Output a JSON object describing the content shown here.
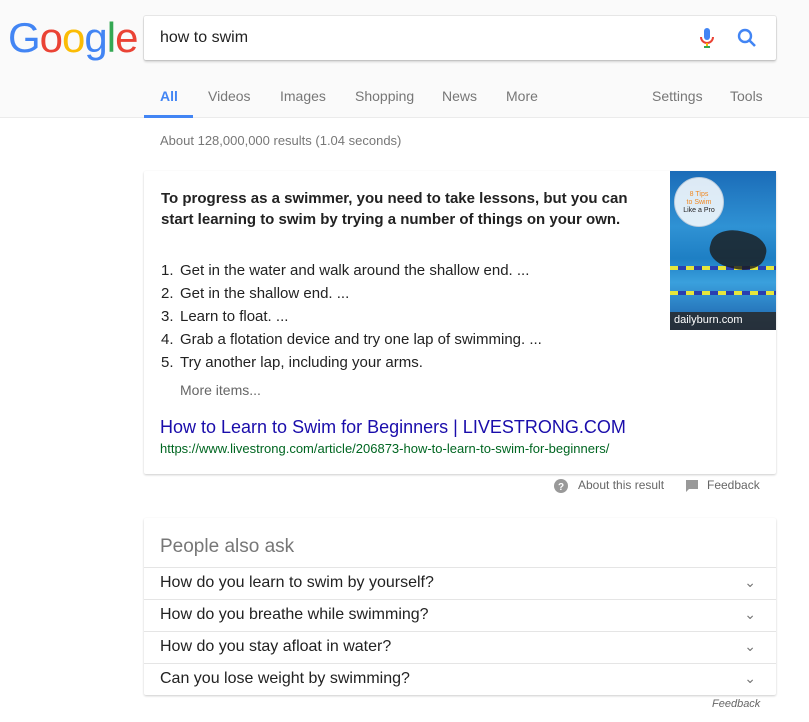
{
  "logo": "Google",
  "search": {
    "query": "how to swim"
  },
  "tabs": [
    "All",
    "Videos",
    "Images",
    "Shopping",
    "News",
    "More"
  ],
  "tools": [
    "Settings",
    "Tools"
  ],
  "stats": "About 128,000,000 results (1.04 seconds)",
  "snippet": {
    "lead": "To progress as a swimmer, you need to take lessons, but you can start learning to swim by trying a number of things on your own.",
    "steps": [
      "Get in the water and walk around the shallow end. ...",
      "Get in the shallow end. ...",
      "Learn to float. ...",
      "Grab a flotation device and try one lap of swimming. ...",
      "Try another lap, including your arms."
    ],
    "more": "More items...",
    "title": "How to Learn to Swim for Beginners | LIVESTRONG.COM",
    "url": "https://www.livestrong.com/article/206873-how-to-learn-to-swim-for-beginners/",
    "image_badge": [
      "8 Tips",
      "to Swim",
      "Like a Pro"
    ],
    "image_caption": "dailyburn.com"
  },
  "about": "About this result",
  "feedback": "Feedback",
  "paa": {
    "title": "People also ask",
    "questions": [
      "How do you learn to swim by yourself?",
      "How do you breathe while swimming?",
      "How do you stay afloat in water?",
      "Can you lose weight by swimming?"
    ],
    "feedback": "Feedback"
  }
}
